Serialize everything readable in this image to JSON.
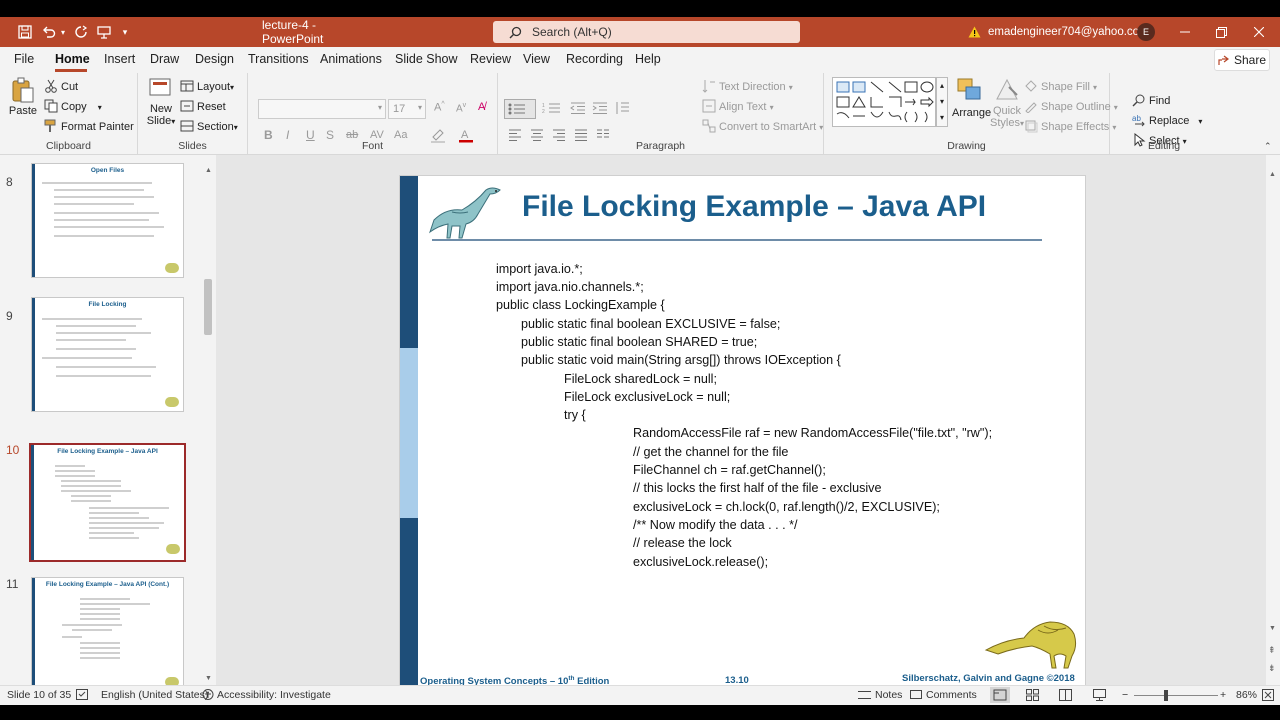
{
  "window": {
    "title": "lecture-4  -  PowerPoint",
    "account": "emadengineer704@yahoo.com",
    "avatar_initial": "E"
  },
  "search": {
    "placeholder": "Search (Alt+Q)"
  },
  "menu": [
    "File",
    "Home",
    "Insert",
    "Draw",
    "Design",
    "Transitions",
    "Animations",
    "Slide Show",
    "Review",
    "View",
    "Recording",
    "Help"
  ],
  "share_label": "Share",
  "ribbon": {
    "clipboard": {
      "paste": "Paste",
      "cut": "Cut",
      "copy": "Copy",
      "format_painter": "Format Painter",
      "label": "Clipboard"
    },
    "slides": {
      "new_slide_1": "New",
      "new_slide_2": "Slide",
      "layout": "Layout",
      "reset": "Reset",
      "section": "Section",
      "label": "Slides"
    },
    "font": {
      "size": "17",
      "label": "Font",
      "styles": [
        "B",
        "I",
        "U",
        "S",
        "ab",
        "AV",
        "Aa"
      ]
    },
    "paragraph": {
      "text_direction": "Text Direction",
      "align_text": "Align Text",
      "convert": "Convert to SmartArt",
      "label": "Paragraph"
    },
    "drawing": {
      "arrange": "Arrange",
      "quick_styles_1": "Quick",
      "quick_styles_2": "Styles",
      "shape_fill": "Shape Fill",
      "shape_outline": "Shape Outline",
      "shape_effects": "Shape Effects",
      "label": "Drawing"
    },
    "editing": {
      "find": "Find",
      "replace": "Replace",
      "select": "Select",
      "label": "Editing"
    }
  },
  "thumbnails": [
    {
      "num": "8",
      "title": "Open Files"
    },
    {
      "num": "9",
      "title": "File Locking"
    },
    {
      "num": "10",
      "title": "File Locking Example – Java API"
    },
    {
      "num": "11",
      "title": "File Locking Example – Java API (Cont.)"
    }
  ],
  "slide": {
    "title": "File Locking Example – Java API",
    "code": [
      "import java.io.*;",
      "import java.nio.channels.*;",
      "public class LockingExample {",
      "public static final boolean EXCLUSIVE = false;",
      "public static final boolean SHARED = true;",
      "public static void main(String arsg[]) throws IOException {",
      "FileLock sharedLock = null;",
      "FileLock exclusiveLock = null;",
      "try {",
      "RandomAccessFile raf = new RandomAccessFile(\"file.txt\", \"rw\");",
      "// get the channel for the file",
      "FileChannel ch = raf.getChannel();",
      "// this locks the first half of the file - exclusive",
      "exclusiveLock = ch.lock(0, raf.length()/2, EXCLUSIVE);",
      "/** Now modify the data . . . */",
      "// release the lock",
      "exclusiveLock.release();"
    ],
    "footer_left": "Operating System Concepts – 10",
    "footer_left_sup": "th",
    "footer_left_end": " Edition",
    "footer_center": "13.10",
    "footer_right": "Silberschatz, Galvin and Gagne ©2018"
  },
  "status": {
    "slide": "Slide 10 of 35",
    "language": "English (United States)",
    "accessibility": "Accessibility: Investigate",
    "notes": "Notes",
    "comments": "Comments",
    "zoom": "86%"
  },
  "colors": {
    "accent": "#b7472a",
    "slide_blue": "#1b5e8c",
    "sidebar_dark": "#1e4e79"
  }
}
